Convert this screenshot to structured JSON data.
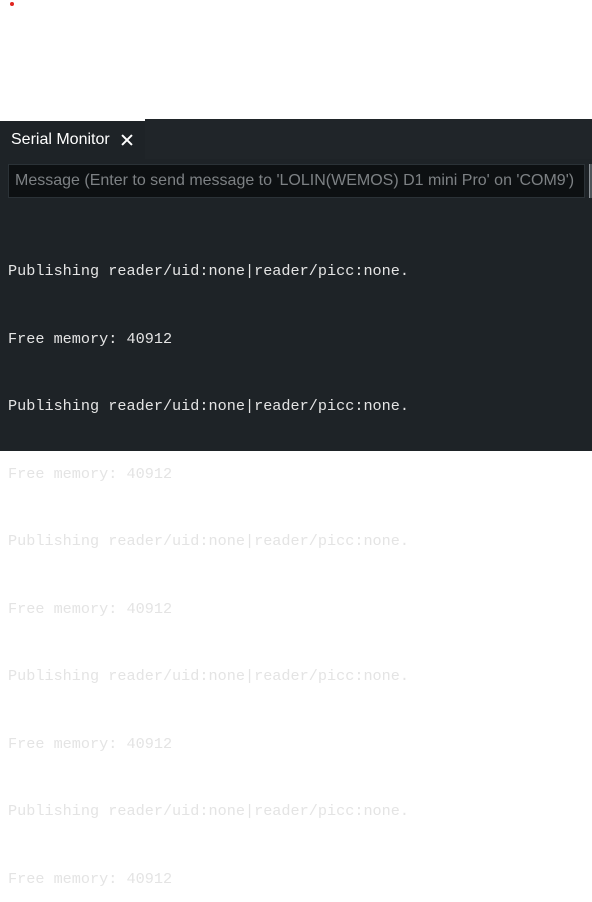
{
  "serial_monitor": {
    "tab_label": "Serial Monitor",
    "close_icon": "close-icon",
    "input": {
      "placeholder": "Message (Enter to send message to 'LOLIN(WEMOS) D1 mini Pro' on 'COM9')",
      "value": ""
    },
    "output_lines": [
      "Publishing reader/uid:none|reader/picc:none.",
      "Free memory: 40912",
      "Publishing reader/uid:none|reader/picc:none.",
      "Free memory: 40912",
      "Publishing reader/uid:none|reader/picc:none.",
      "Free memory: 40912",
      "Publishing reader/uid:none|reader/picc:none.",
      "Free memory: 40912",
      "Publishing reader/uid:none|reader/picc:none.",
      "Free memory: 40912"
    ]
  },
  "colors": {
    "panel_bg": "#1e2327",
    "input_bg": "#0d1012",
    "text": "#e4e4e4",
    "placeholder": "#7d8184",
    "error_dot": "#e0241f"
  }
}
